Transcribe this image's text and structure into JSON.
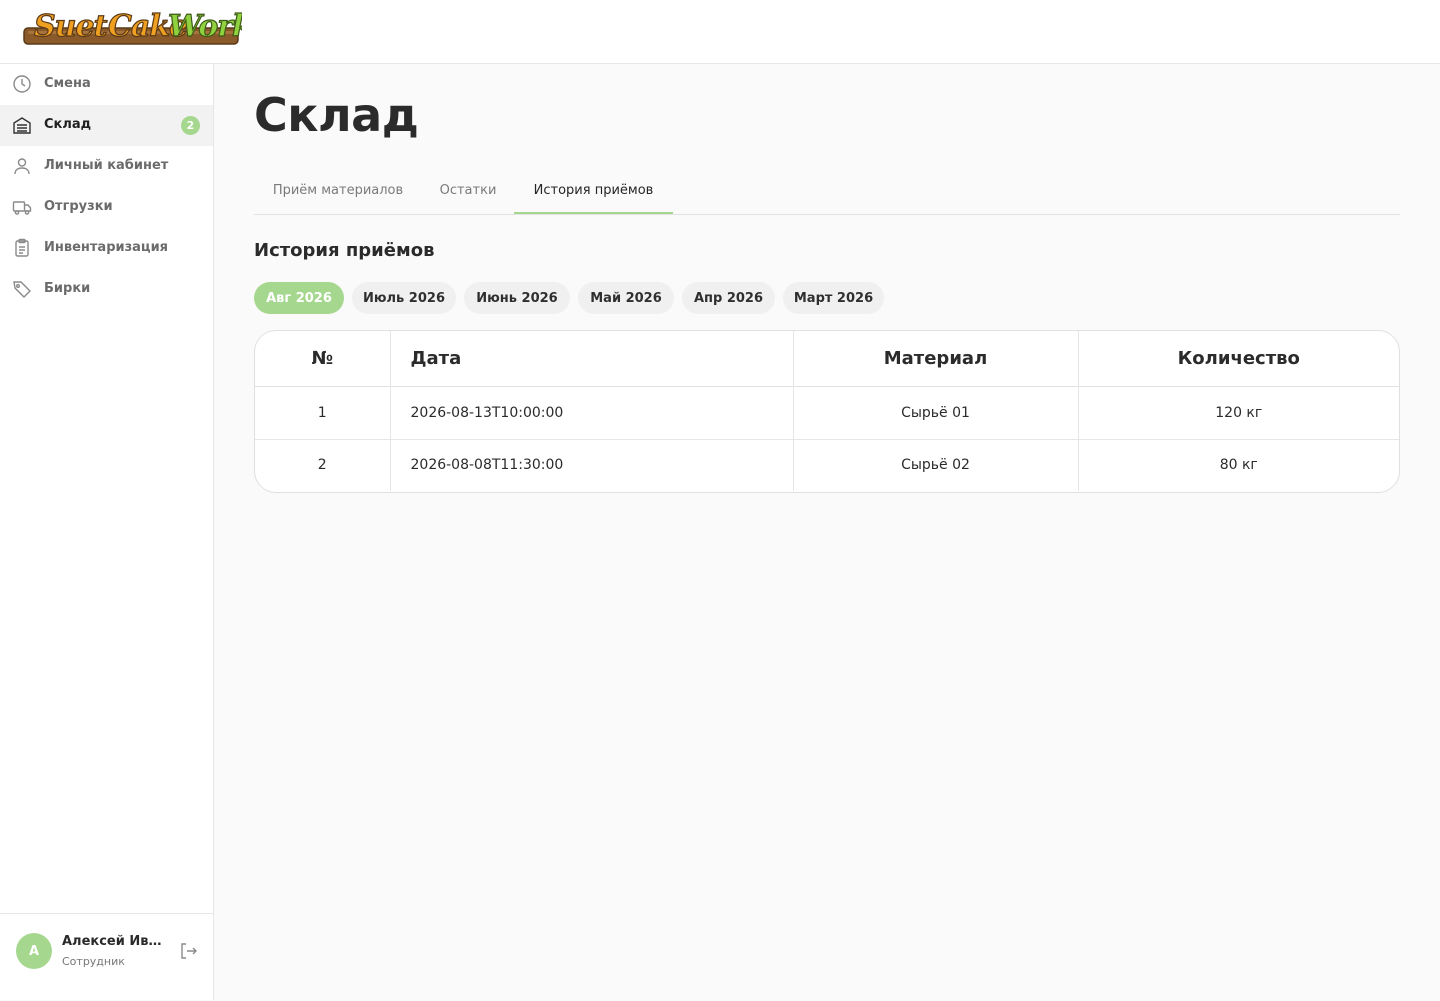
{
  "header": {
    "logo_text_1": "Suet",
    "logo_text_2": "Cake",
    "logo_text_3": "Work"
  },
  "sidebar": {
    "items": [
      {
        "label": "Смена",
        "icon": "clock-icon"
      },
      {
        "label": "Склад",
        "icon": "warehouse-icon",
        "badge": "2",
        "active": true
      },
      {
        "label": "Личный кабинет",
        "icon": "user-icon"
      },
      {
        "label": "Отгрузки",
        "icon": "truck-icon"
      },
      {
        "label": "Инвентаризация",
        "icon": "clipboard-icon"
      },
      {
        "label": "Бирки",
        "icon": "tag-icon"
      }
    ],
    "user": {
      "initial": "А",
      "name": "Алексей Иван...",
      "role": "Сотрудник"
    }
  },
  "main": {
    "title": "Склад",
    "tabs": [
      {
        "label": "Приём материалов"
      },
      {
        "label": "Остатки"
      },
      {
        "label": "История приёмов",
        "active": true
      }
    ],
    "section_title": "История приёмов",
    "months": [
      {
        "label": "Авг 2026",
        "active": true
      },
      {
        "label": "Июль 2026"
      },
      {
        "label": "Июнь 2026"
      },
      {
        "label": "Май 2026"
      },
      {
        "label": "Апр 2026"
      },
      {
        "label": "Март 2026"
      }
    ],
    "table": {
      "columns": [
        "№",
        "Дата",
        "Материал",
        "Количество"
      ],
      "rows": [
        [
          "1",
          "2026-08-13T10:00:00",
          "Сырьё 01",
          "120 кг"
        ],
        [
          "2",
          "2026-08-08T11:30:00",
          "Сырьё 02",
          "80 кг"
        ]
      ]
    }
  },
  "colors": {
    "accent": "#a5d88e",
    "background": "#fafafa",
    "logo_orange": "#f0a020",
    "logo_green": "#8fd13f",
    "logo_wood": "#8a5a2b"
  }
}
